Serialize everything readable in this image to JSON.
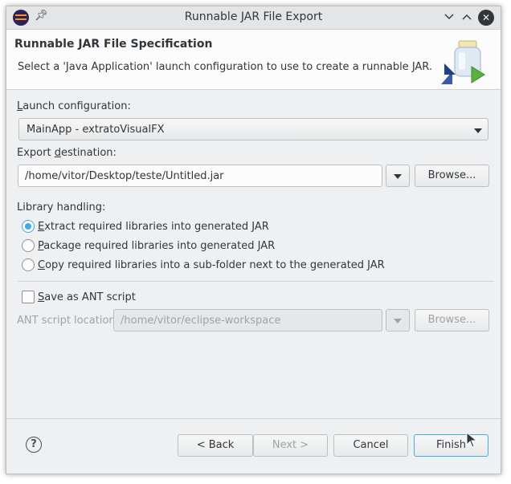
{
  "window": {
    "title": "Runnable JAR File Export",
    "icons": {
      "app": "eclipse-icon",
      "pin": "pin-icon",
      "minimize": "chevron-down-icon",
      "maximize": "chevron-up-icon",
      "close": "close-icon"
    }
  },
  "header": {
    "title": "Runnable JAR File Specification",
    "description": "Select a 'Java Application' launch configuration to use to create a runnable JAR.",
    "icon": "jar-export-icon"
  },
  "launch": {
    "label_prefix": "",
    "label_mnemonic": "L",
    "label_rest": "aunch configuration:",
    "selected": "MainApp - extratoVisualFX"
  },
  "export": {
    "label_prefix": "Export ",
    "label_mnemonic": "d",
    "label_rest": "estination:",
    "value": "/home/vitor/Desktop/teste/Untitled.jar",
    "browse": "Browse..."
  },
  "library": {
    "label": "Library handling:",
    "options": [
      {
        "mnemonic": "E",
        "rest": "xtract required libraries into generated JAR",
        "selected": true
      },
      {
        "mnemonic": "P",
        "rest": "ackage required libraries into generated JAR",
        "selected": false
      },
      {
        "mnemonic": "C",
        "rest": "opy required libraries into a sub-folder next to the generated JAR",
        "selected": false
      }
    ]
  },
  "ant": {
    "checkbox_mnemonic": "S",
    "checkbox_rest": "ave as ANT script",
    "checked": false,
    "location_label": "ANT script location:",
    "location_value": "/home/vitor/eclipse-workspace",
    "browse": "Browse..."
  },
  "footer": {
    "help": "?",
    "back": "< Back",
    "next": "Next >",
    "cancel": "Cancel",
    "finish": "Finish"
  },
  "colors": {
    "accent": "#3daee9",
    "window_bg": "#eff0f1"
  }
}
